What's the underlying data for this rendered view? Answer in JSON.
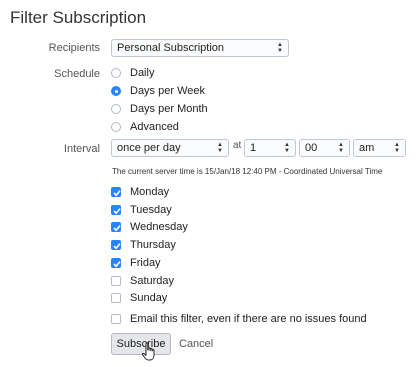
{
  "title": "Filter Subscription",
  "recipients": {
    "label": "Recipients",
    "value": "Personal Subscription"
  },
  "schedule": {
    "label": "Schedule",
    "options": [
      {
        "label": "Daily",
        "selected": false
      },
      {
        "label": "Days per Week",
        "selected": true
      },
      {
        "label": "Days per Month",
        "selected": false
      },
      {
        "label": "Advanced",
        "selected": false
      }
    ]
  },
  "interval": {
    "label": "Interval",
    "frequency": "once per day",
    "at_label": "at",
    "hour": "1",
    "minute": "00",
    "ampm": "am",
    "server_time_note": "The current server time is 15/Jan/18 12:40 PM - Coordinated Universal Time"
  },
  "days": [
    {
      "label": "Monday",
      "checked": true
    },
    {
      "label": "Tuesday",
      "checked": true
    },
    {
      "label": "Wednesday",
      "checked": true
    },
    {
      "label": "Thursday",
      "checked": true
    },
    {
      "label": "Friday",
      "checked": true
    },
    {
      "label": "Saturday",
      "checked": false
    },
    {
      "label": "Sunday",
      "checked": false
    }
  ],
  "email_empty": {
    "label": "Email this filter, even if there are no issues found",
    "checked": false
  },
  "actions": {
    "subscribe": "Subscribe",
    "cancel": "Cancel"
  },
  "colors": {
    "accent": "#2684ff"
  }
}
